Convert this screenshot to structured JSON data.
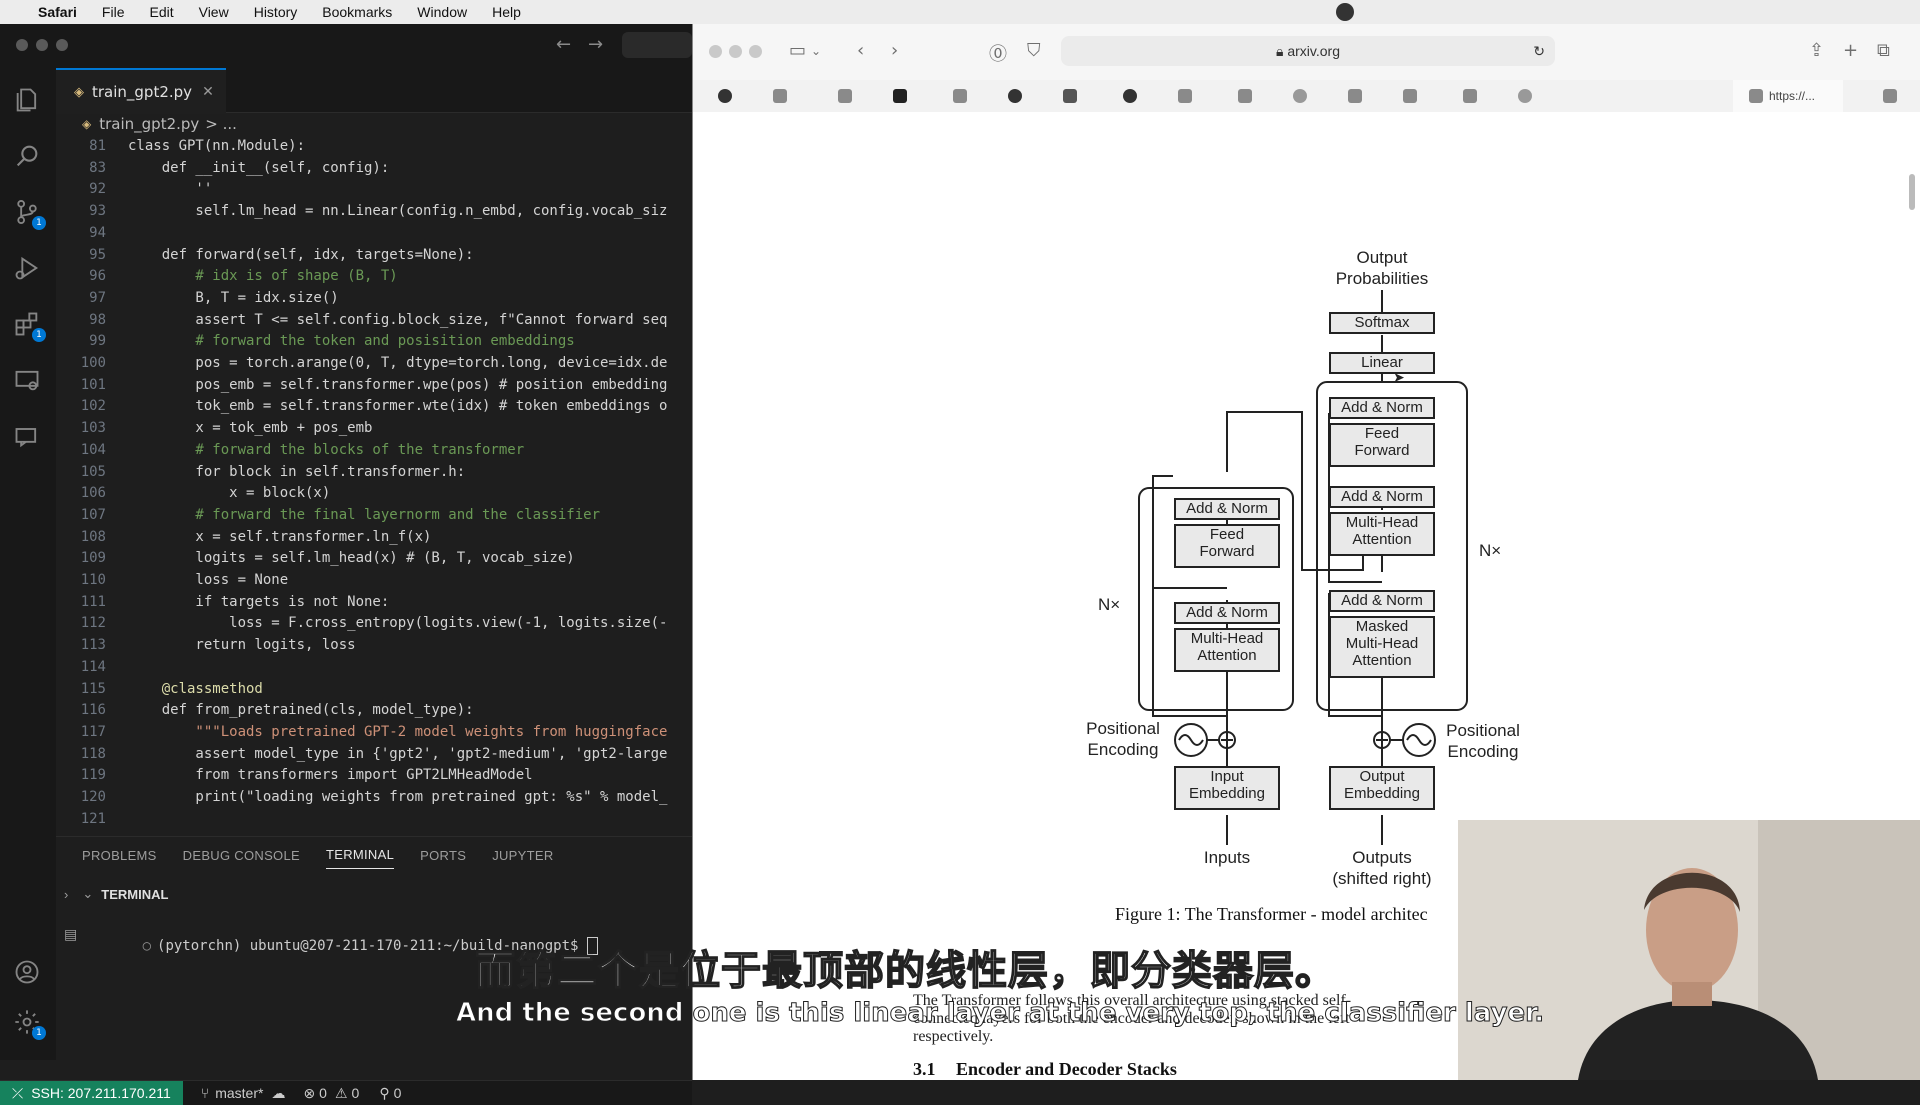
{
  "menubar": {
    "app": "Safari",
    "items": [
      "File",
      "Edit",
      "View",
      "History",
      "Bookmarks",
      "Window",
      "Help"
    ]
  },
  "vscode": {
    "tab_label": "train_gpt2.py",
    "breadcrumb_file": "train_gpt2.py",
    "breadcrumb_rest": "> ...",
    "activity_badges": {
      "source_control": "1",
      "extensions": "1",
      "settings": "1"
    },
    "code_lines": [
      {
        "n": "81",
        "text": "class GPT(nn.Module):"
      },
      {
        "n": "83",
        "text": "    def __init__(self, config):"
      },
      {
        "n": "92",
        "text": "        ''"
      },
      {
        "n": "93",
        "text": "        self.lm_head = nn.Linear(config.n_embd, config.vocab_siz"
      },
      {
        "n": "94",
        "text": ""
      },
      {
        "n": "95",
        "text": "    def forward(self, idx, targets=None):"
      },
      {
        "n": "96",
        "text": "        # idx is of shape (B, T)"
      },
      {
        "n": "97",
        "text": "        B, T = idx.size()"
      },
      {
        "n": "98",
        "text": "        assert T <= self.config.block_size, f\"Cannot forward seq"
      },
      {
        "n": "99",
        "text": "        # forward the token and posisition embeddings"
      },
      {
        "n": "100",
        "text": "        pos = torch.arange(0, T, dtype=torch.long, device=idx.de"
      },
      {
        "n": "101",
        "text": "        pos_emb = self.transformer.wpe(pos) # position embedding"
      },
      {
        "n": "102",
        "text": "        tok_emb = self.transformer.wte(idx) # token embeddings o"
      },
      {
        "n": "103",
        "text": "        x = tok_emb + pos_emb"
      },
      {
        "n": "104",
        "text": "        # forward the blocks of the transformer"
      },
      {
        "n": "105",
        "text": "        for block in self.transformer.h:"
      },
      {
        "n": "106",
        "text": "            x = block(x)"
      },
      {
        "n": "107",
        "text": "        # forward the final layernorm and the classifier"
      },
      {
        "n": "108",
        "text": "        x = self.transformer.ln_f(x)"
      },
      {
        "n": "109",
        "text": "        logits = self.lm_head(x) # (B, T, vocab_size)"
      },
      {
        "n": "110",
        "text": "        loss = None"
      },
      {
        "n": "111",
        "text": "        if targets is not None:"
      },
      {
        "n": "112",
        "text": "            loss = F.cross_entropy(logits.view(-1, logits.size(-"
      },
      {
        "n": "113",
        "text": "        return logits, loss"
      },
      {
        "n": "114",
        "text": ""
      },
      {
        "n": "115",
        "text": "    @classmethod"
      },
      {
        "n": "116",
        "text": "    def from_pretrained(cls, model_type):"
      },
      {
        "n": "117",
        "text": "        \"\"\"Loads pretrained GPT-2 model weights from huggingface"
      },
      {
        "n": "118",
        "text": "        assert model_type in {'gpt2', 'gpt2-medium', 'gpt2-large"
      },
      {
        "n": "119",
        "text": "        from transformers import GPT2LMHeadModel"
      },
      {
        "n": "120",
        "text": "        print(\"loading weights from pretrained gpt: %s\" % model_"
      },
      {
        "n": "121",
        "text": ""
      }
    ],
    "panel_tabs": [
      "PROBLEMS",
      "DEBUG CONSOLE",
      "TERMINAL",
      "PORTS",
      "JUPYTER"
    ],
    "active_panel_tab": "TERMINAL",
    "terminal_header": "TERMINAL",
    "terminal_prompt": "(pytorchn) ubuntu@207-211-170-211:~/build-nanogpt$ ",
    "status": {
      "ssh": "SSH: 207.211.170.211",
      "branch": "master*",
      "errors": "0",
      "warnings": "0",
      "ports": "0"
    }
  },
  "safari": {
    "url": "arxiv.org",
    "active_tab": "https://...",
    "figure": {
      "output_label_1": "Output",
      "output_label_2": "Probabilities",
      "softmax": "Softmax",
      "linear": "Linear",
      "add_norm": "Add & Norm",
      "feed_forward_1": "Feed",
      "feed_forward_2": "Forward",
      "mha_1": "Multi-Head",
      "mha_2": "Attention",
      "masked_1": "Masked",
      "masked_2": "Multi-Head",
      "masked_3": "Attention",
      "nx": "N×",
      "pos_enc_1": "Positional",
      "pos_enc_2": "Encoding",
      "input_emb_1": "Input",
      "input_emb_2": "Embedding",
      "output_emb_1": "Output",
      "output_emb_2": "Embedding",
      "inputs": "Inputs",
      "outputs_1": "Outputs",
      "outputs_2": "(shifted right)"
    },
    "caption": "Figure 1: The Transformer - model architec",
    "para_line_1": "The Transformer follows this overall architecture using stacked self-",
    "para_line_2": "connected layers for both the encoder and decoder, shown in the left",
    "para_line_3": "respectively.",
    "section_number": "3.1",
    "section_title": "Encoder and Decoder Stacks"
  },
  "subtitles": {
    "zh": "而第二个是位于最顶部的线性层，即分类器层。",
    "en": "And the second one is this linear layer at the very top, the classifier layer."
  },
  "colors": {
    "vscode_bg": "#1e1e1e",
    "accent": "#0078d4",
    "ssh_green": "#16825d",
    "diagram_block": "#e9e9e9"
  }
}
